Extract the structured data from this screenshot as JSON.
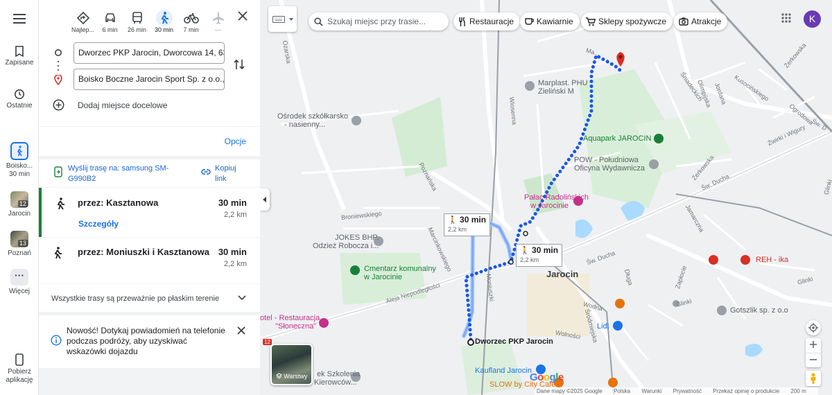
{
  "rail": {
    "saved": "Zapisane",
    "recent": "Ostatnie",
    "route_item": {
      "label": "Boisko...",
      "time": "30 min"
    },
    "item_jarocin": {
      "label": "Jarocin",
      "badge": "12"
    },
    "item_poznan": {
      "label": "Poznań",
      "badge": "13"
    },
    "more": "Więcej",
    "get_app": "Pobierz aplikację"
  },
  "modes": [
    {
      "name": "best",
      "label": "Najlep..."
    },
    {
      "name": "car",
      "label": "6 min"
    },
    {
      "name": "transit",
      "label": "26 min"
    },
    {
      "name": "walk",
      "label": "30 min"
    },
    {
      "name": "bike",
      "label": "7 min"
    },
    {
      "name": "flight",
      "label": "—"
    }
  ],
  "directions": {
    "origin": "Dworzec PKP Jarocin, Dworcowa 14, 63-200",
    "destination": "Boisko Boczne Jarocin Sport Sp. z o.o., M",
    "add_stop": "Dodaj miejsce docelowe",
    "options": "Opcje",
    "send_route": "Wyślij trasę na: samsung SM-G990B2",
    "copy_link": "Kopiuj link"
  },
  "routes": [
    {
      "via": "przez: Kasztanowa",
      "time": "30 min",
      "distance": "2,2 km",
      "details": "Szczegóły"
    },
    {
      "via": "przez: Moniuszki i Kasztanowa",
      "time": "30 min",
      "distance": "2,2 km"
    }
  ],
  "flat_note": "Wszystkie trasy są przeważnie po płaskim terenie",
  "notice": "Nowość! Dotykaj powiadomień na telefonie podczas podróży, aby uzyskiwać wskazówki dojazdu",
  "map": {
    "search_placeholder": "Szukaj miejsc przy trasie...",
    "chips": [
      "Restauracje",
      "Kawiarnie",
      "Sklepy spożywcze",
      "Atrakcje"
    ],
    "avatar": "K",
    "layers": "Warstwy",
    "time_box_1": {
      "time": "30 min",
      "dist": "2,2 km"
    },
    "time_box_2": {
      "time": "30 min",
      "dist": "2,2 km"
    },
    "origin_label": "Dworzec PKP Jarocin",
    "places": {
      "marplast": "Marplast. PHU",
      "zielinski": "Zieliński M",
      "osrodek": "Ośrodek szkółkarsko",
      "osrodek2": "- nasienny...",
      "aquapark": "Aquapark JAROCIN",
      "pow": "POW - Południowa",
      "pow2": "Oficyna Wydawnicza",
      "palac": "Pałac Radolińskich",
      "palac2": "w Jarocinie",
      "jokes": "JOKES BHP.",
      "jokes2": "Odzież Robocza i...",
      "cmentarz": "Cmentarz komunalny",
      "cmentarz2": "w Jarocinie",
      "town": "Jarocin",
      "hotel": "otel - Restauracja",
      "hotel2": "\"Słoneczna\"",
      "kaufland": "Kaufland Jarocin",
      "slow": "SLOW by City Cafe",
      "lidl": "Lidl",
      "gotszlik": "Gotszlik sp. z o.o",
      "reh": "REH - ika",
      "szkolenia": "ek Szkolenia",
      "szkolenia2": "Kierowców..."
    },
    "roads": {
      "poznanska": "Poznańska",
      "wiosenna": "Wiosenna",
      "broniewskiego": "Broniewskiego",
      "marcinkowskiego": "Marcinkowskiego",
      "moniuszki": "Moniuszki",
      "aleja": "Aleja Niepodległości",
      "swducha": "Św. Ducha",
      "swducha2": "Św. Ducha",
      "zerkowska": "Żerkowska",
      "zerkowska2": "Żerkowska",
      "jamarczna": "Jamarczna",
      "dluga": "Długa",
      "zaplocie": "Zapłocie",
      "glinki": "Glinki",
      "glinki2": "Glinki",
      "wodna": "Wodna",
      "srodmiejska": "Śródmiejska",
      "wolnosci": "Wolności",
      "ozarska": "Ozarska",
      "mazurska": "Ma...",
      "zwirki": "Żwirki i Wigury",
      "kusocinskiego": "Kusocińskiego",
      "olimpijska": "Olimpijska",
      "sniadeckich": "Śniadeckich",
      "jordana": "Jordana",
      "ogrodowa": "Ogrodowa",
      "sw": "Św. D",
      "lipowa": "Lipowa",
      "route12": "12",
      "glinki3": "Glinki"
    },
    "footer": [
      "Dane mapy ©2025 Google",
      "Polska",
      "Warunki",
      "Prywatność",
      "Przekaż opinię o produkcie",
      "200 m"
    ],
    "google": "Google"
  }
}
